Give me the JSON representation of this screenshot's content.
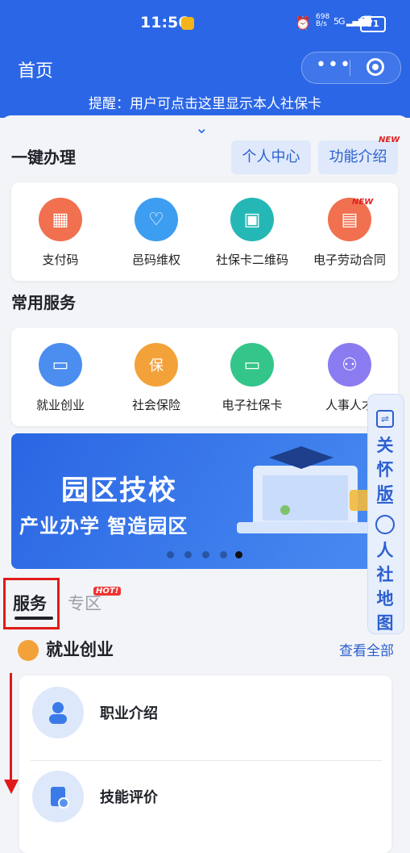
{
  "status_bar": {
    "time": "11:56",
    "net_speed_value": "698",
    "net_speed_unit": "B/s",
    "net_type": "5G",
    "battery": "71"
  },
  "header": {
    "title": "首页",
    "more_glyph": "•••",
    "reminder": "提醒：用户可点击这里显示本人社保卡"
  },
  "quick": {
    "title": "一键办理",
    "personal_center": "个人中心",
    "feature_intro": "功能介绍",
    "new_badge": "NEW",
    "items": [
      {
        "label": "支付码",
        "icon": "qr-pay-icon",
        "color": "#f0704f"
      },
      {
        "label": "邑码维权",
        "icon": "shield-badge-icon",
        "color": "#3d9df0"
      },
      {
        "label": "社保卡二维码",
        "icon": "qr-grid-icon",
        "color": "#25b7b5"
      },
      {
        "label": "电子劳动合同",
        "icon": "contract-icon",
        "color": "#f0704f",
        "badge": "NEW"
      }
    ]
  },
  "common": {
    "title": "常用服务",
    "items": [
      {
        "label": "就业创业",
        "icon": "briefcase-icon",
        "color": "#4b8ef0"
      },
      {
        "label": "社会保险",
        "icon": "insurance-icon",
        "color": "#f3a23a",
        "glyph": "保"
      },
      {
        "label": "电子社保卡",
        "icon": "card-icon",
        "color": "#33c58a"
      },
      {
        "label": "人事人才",
        "icon": "people-icon",
        "color": "#8a7cf0"
      }
    ]
  },
  "banner": {
    "title": "园区技校",
    "subtitle": "产业办学 智造园区",
    "slides": 5,
    "active_slide": 5
  },
  "side_float": {
    "care_chars": [
      "关",
      "怀",
      "版"
    ],
    "map_chars": [
      "人",
      "社",
      "地",
      "图"
    ]
  },
  "tabs": {
    "service": "服务",
    "zone": "专区",
    "hot_badge": "HOT!"
  },
  "employment": {
    "title": "就业创业",
    "more": "查看全部",
    "items": [
      {
        "label": "职业介绍",
        "icon": "career-intro-icon"
      },
      {
        "label": "技能评价",
        "icon": "skill-cert-icon"
      }
    ]
  },
  "colors": {
    "brand_blue": "#2b66e6",
    "annotation_red": "#e01a1a"
  }
}
